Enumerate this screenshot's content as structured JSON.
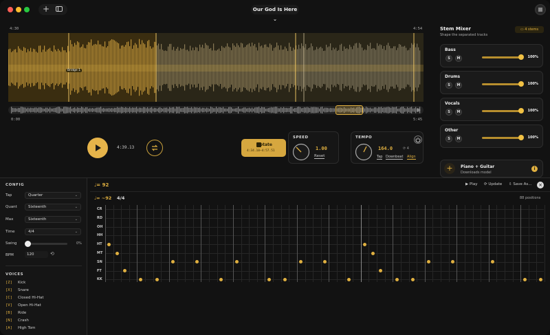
{
  "window": {
    "title": "Our God Is Here",
    "chevron": "⌄"
  },
  "colors": {
    "accent": "#f1c144",
    "bg": "#121212",
    "panel": "#161616"
  },
  "waveform": {
    "time_left": "4:30",
    "time_right": "4:54",
    "section_label": "Bridge 1",
    "overview_start": "0:00",
    "overview_end": "5:45"
  },
  "transport": {
    "position": "4:39.13"
  },
  "notate": {
    "label": "Notate",
    "range": "4:34.10–4:57.51"
  },
  "speed": {
    "label": "SPEED",
    "value": "1.00",
    "reset": "Reset"
  },
  "tempo": {
    "label": "TEMPO",
    "value": "164.0",
    "count": "4",
    "tap": "Tap",
    "downbeat": "Downbeat",
    "align": "Align"
  },
  "mixer": {
    "title": "Stem Mixer",
    "subtitle": "Shape the separated tracks",
    "count": "4 stems",
    "stems": [
      {
        "name": "Bass",
        "solo": "S",
        "mute": "M",
        "volume": "100%",
        "level": 1.0
      },
      {
        "name": "Drums",
        "solo": "S",
        "mute": "M",
        "volume": "100%",
        "level": 1.0
      },
      {
        "name": "Vocals",
        "solo": "S",
        "mute": "M",
        "volume": "100%",
        "level": 1.0
      },
      {
        "name": "Other",
        "solo": "S",
        "mute": "M",
        "volume": "100%",
        "level": 1.0
      }
    ],
    "model": {
      "title": "Piano + Guitar",
      "subtitle": "Downloads model"
    }
  },
  "config": {
    "title": "CONFIG",
    "tap_label": "Tap",
    "tap_value": "Quarter",
    "quant_label": "Quant",
    "quant_value": "Sixteenth",
    "max_label": "Max",
    "max_value": "Sixteenth",
    "time_label": "Time",
    "time_value": "4/4",
    "swing_label": "Swing",
    "swing_value": "0%",
    "swing_level": 0,
    "bpm_label": "BPM",
    "bpm_value": "120"
  },
  "voices": {
    "title": "VOICES",
    "items": [
      {
        "key": "[Z]",
        "name": "Kick"
      },
      {
        "key": "[X]",
        "name": "Snare"
      },
      {
        "key": "[C]",
        "name": "Closed Hi-Hat"
      },
      {
        "key": "[V]",
        "name": "Open Hi-Hat"
      },
      {
        "key": "[B]",
        "name": "Ride"
      },
      {
        "key": "[N]",
        "name": "Crash"
      },
      {
        "key": "[A]",
        "name": "High Tom"
      }
    ]
  },
  "notation": {
    "tempo1": "♩= 92",
    "tempo2": "♩= ~92",
    "timesig": "4/4",
    "play": "Play",
    "update": "Update",
    "save": "Save As...",
    "positions": "88 positions",
    "rows": [
      "CR",
      "RD",
      "OH",
      "HH",
      "HT",
      "MT",
      "SN",
      "FT",
      "KK"
    ]
  }
}
